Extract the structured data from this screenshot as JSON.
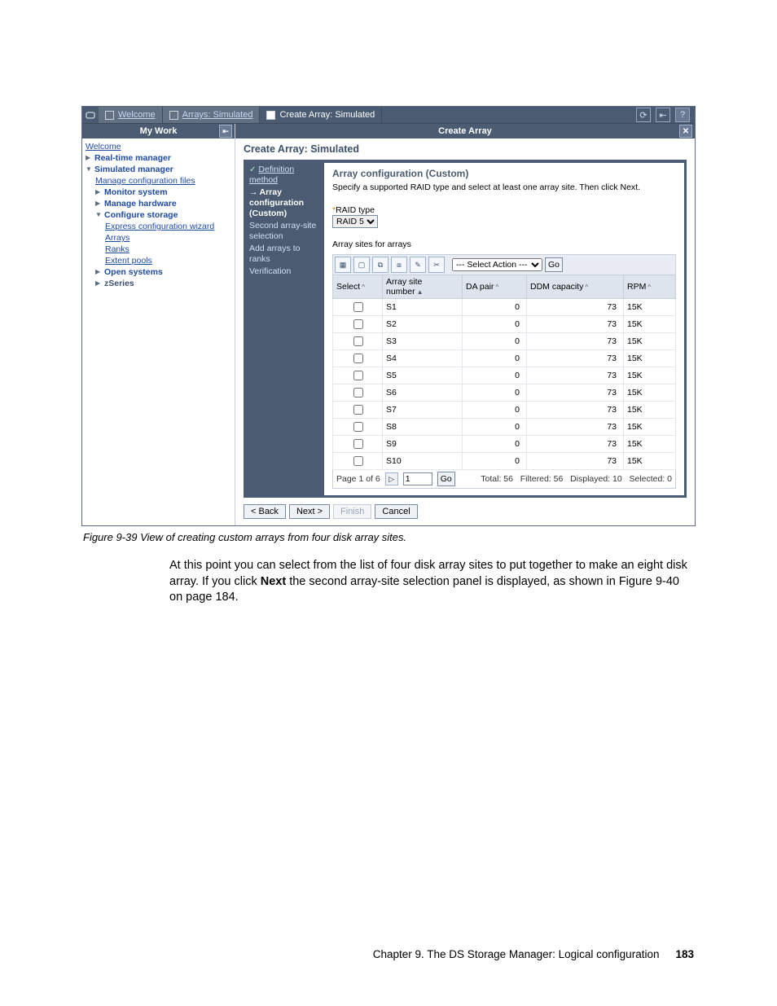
{
  "tabs": {
    "welcome": "Welcome",
    "arrays": "Arrays: Simulated",
    "create": "Create Array: Simulated"
  },
  "top_icons": {
    "refresh": "↻",
    "back": "◁",
    "help": "?"
  },
  "left": {
    "header": "My Work",
    "items": {
      "welcome": "Welcome",
      "realtime": "Real-time manager",
      "simulated": "Simulated manager",
      "manage_files": "Manage configuration files",
      "monitor": "Monitor system",
      "manage_hw": "Manage hardware",
      "configure": "Configure storage",
      "express": "Express configuration wizard",
      "arrays": "Arrays",
      "ranks": "Ranks",
      "extent": "Extent pools",
      "open": "Open systems",
      "zseries": "zSeries"
    }
  },
  "right": {
    "crumb": "Create Array",
    "title": "Create Array: Simulated"
  },
  "wizard": {
    "nav": {
      "definition": "Definition method",
      "array_conf": "Array configuration (Custom)",
      "second": "Second array-site selection",
      "add": "Add arrays to ranks",
      "verify": "Verification"
    },
    "content": {
      "title": "Array configuration (Custom)",
      "desc": "Specify a supported RAID type and select at least one array site. Then click Next.",
      "raid_label": "RAID type",
      "raid_value": "RAID 5",
      "sites_label": "Array sites for arrays",
      "select_action": "--- Select Action ---",
      "go": "Go"
    },
    "table": {
      "cols": {
        "select": "Select",
        "site": "Array site number",
        "da": "DA pair",
        "ddm": "DDM capacity",
        "rpm": "RPM"
      },
      "rows": [
        {
          "site": "S1",
          "da": "0",
          "ddm": "73",
          "rpm": "15K"
        },
        {
          "site": "S2",
          "da": "0",
          "ddm": "73",
          "rpm": "15K"
        },
        {
          "site": "S3",
          "da": "0",
          "ddm": "73",
          "rpm": "15K"
        },
        {
          "site": "S4",
          "da": "0",
          "ddm": "73",
          "rpm": "15K"
        },
        {
          "site": "S5",
          "da": "0",
          "ddm": "73",
          "rpm": "15K"
        },
        {
          "site": "S6",
          "da": "0",
          "ddm": "73",
          "rpm": "15K"
        },
        {
          "site": "S7",
          "da": "0",
          "ddm": "73",
          "rpm": "15K"
        },
        {
          "site": "S8",
          "da": "0",
          "ddm": "73",
          "rpm": "15K"
        },
        {
          "site": "S9",
          "da": "0",
          "ddm": "73",
          "rpm": "15K"
        },
        {
          "site": "S10",
          "da": "0",
          "ddm": "73",
          "rpm": "15K"
        }
      ],
      "pager": {
        "label": "Page 1 of 6",
        "input": "1",
        "go": "Go",
        "total": "Total: 56",
        "filtered": "Filtered: 56",
        "displayed": "Displayed: 10",
        "selected": "Selected: 0"
      }
    },
    "buttons": {
      "back": "< Back",
      "next": "Next >",
      "finish": "Finish",
      "cancel": "Cancel"
    }
  },
  "caption": "Figure 9-39   View of creating custom arrays from four disk array sites.",
  "body": {
    "p1a": "At this point you can select from the list of four disk array sites to put together to make an eight disk array. If you click ",
    "p1b": "Next",
    "p1c": " the second array-site selection panel is displayed, as shown in Figure 9-40 on page 184."
  },
  "footer": {
    "chapter": "Chapter 9. The DS Storage Manager: Logical configuration",
    "page": "183"
  }
}
